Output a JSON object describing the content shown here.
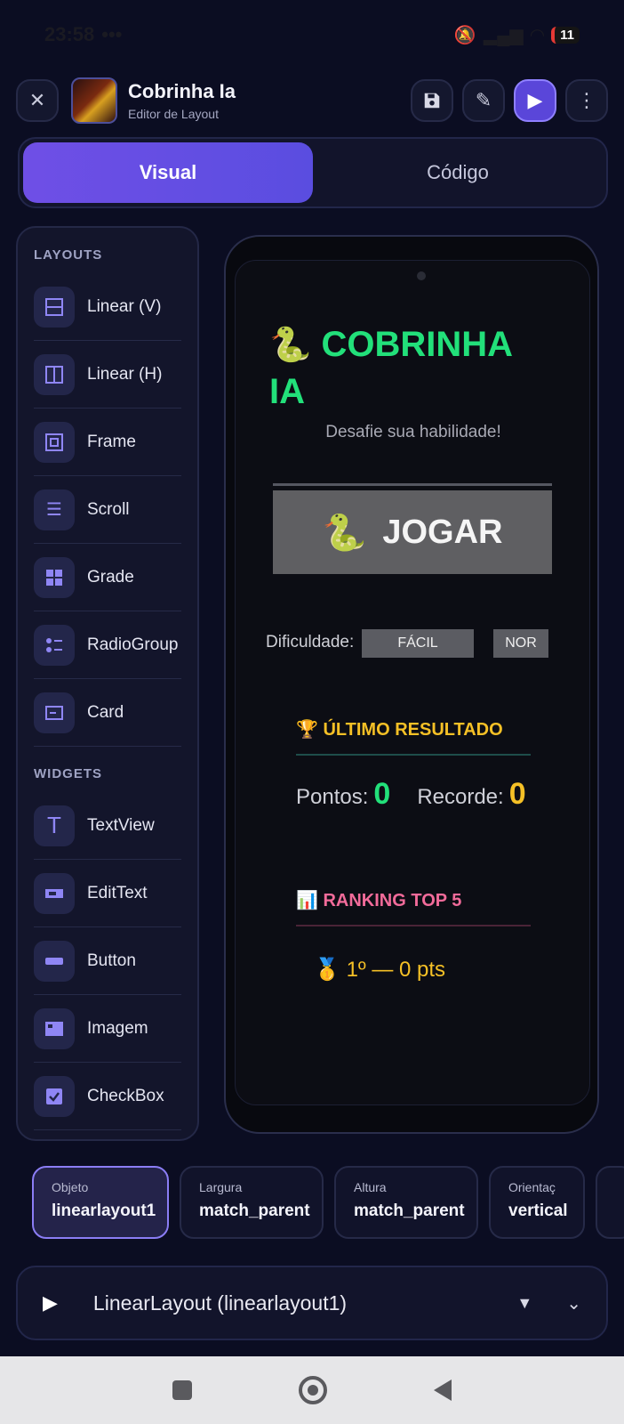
{
  "status": {
    "time": "23:58",
    "dots": "•••",
    "battery": "11"
  },
  "header": {
    "title": "Cobrinha Ia",
    "subtitle": "Editor de Layout"
  },
  "tabs": [
    {
      "label": "Visual",
      "active": true
    },
    {
      "label": "Código",
      "active": false
    }
  ],
  "palette": {
    "layouts_title": "LAYOUTS",
    "layouts": [
      {
        "label": "Linear (V)",
        "icon": "linear-vertical-icon"
      },
      {
        "label": "Linear (H)",
        "icon": "linear-horizontal-icon"
      },
      {
        "label": "Frame",
        "icon": "frame-icon"
      },
      {
        "label": "Scroll",
        "icon": "scroll-icon"
      },
      {
        "label": "Grade",
        "icon": "grid-icon"
      },
      {
        "label": "RadioGroup",
        "icon": "radiogroup-icon"
      },
      {
        "label": "Card",
        "icon": "card-icon"
      }
    ],
    "widgets_title": "WIDGETS",
    "widgets": [
      {
        "label": "TextView",
        "icon": "textview-icon"
      },
      {
        "label": "EditText",
        "icon": "edittext-icon"
      },
      {
        "label": "Button",
        "icon": "button-icon"
      },
      {
        "label": "Imagem",
        "icon": "image-icon"
      },
      {
        "label": "CheckBox",
        "icon": "checkbox-icon"
      }
    ]
  },
  "preview": {
    "title": "COBRINHA IA",
    "subtitle": "Desafie sua habilidade!",
    "play_label": "JOGAR",
    "difficulty_label": "Dificuldade:",
    "difficulty_easy": "FÁCIL",
    "difficulty_normal": "NOR",
    "result_title": "ÚLTIMO RESULTADO",
    "points_label": "Pontos:",
    "points_value": "0",
    "record_label": "Recorde:",
    "record_value": "0",
    "ranking_title": "RANKING TOP 5",
    "rank_1": "1º — 0 pts"
  },
  "properties": [
    {
      "label": "Objeto",
      "value": "linearlayout1",
      "active": true
    },
    {
      "label": "Largura",
      "value": "match_parent"
    },
    {
      "label": "Altura",
      "value": "match_parent"
    },
    {
      "label": "Orientaç",
      "value": "vertical"
    }
  ],
  "tree": {
    "text": "LinearLayout  (linearlayout1)"
  }
}
